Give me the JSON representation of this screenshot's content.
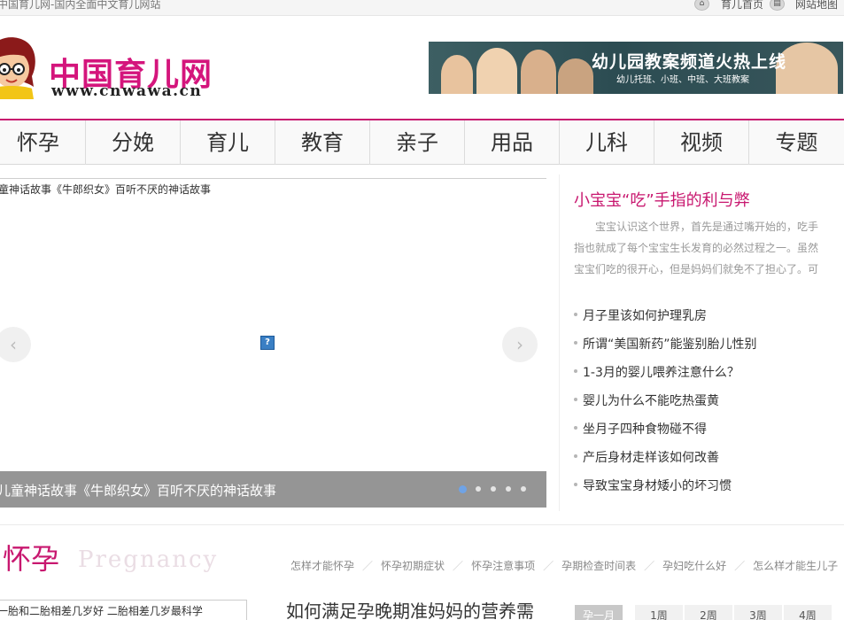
{
  "topbar": {
    "site_title": "中国育儿网-国内全面中文育儿网站",
    "links": [
      {
        "icon": "home-icon",
        "icon_glyph": "⌂",
        "label": "育儿首页"
      },
      {
        "icon": "sitemap-icon",
        "icon_glyph": "▤",
        "label": "网站地图"
      }
    ]
  },
  "header": {
    "logo_cn": "中国育儿网",
    "logo_url": "www.cnwawa.cn",
    "banner_title": "幼儿园教案频道火热上线",
    "banner_sub": "幼儿托班、小班、中班、大班教案"
  },
  "nav": {
    "items": [
      "怀孕",
      "分娩",
      "育儿",
      "教育",
      "亲子",
      "用品",
      "儿科",
      "视频",
      "专题"
    ]
  },
  "slider": {
    "caption_top": "童神话故事《牛郎织女》百听不厌的神话故事",
    "caption_bottom": "儿童神话故事《牛郎织女》百听不厌的神话故事",
    "prev_glyph": "‹",
    "next_glyph": "›",
    "broken_image_glyph": "?",
    "dot_count": 5,
    "active_dot": 1
  },
  "featured": {
    "title": "小宝宝“吃”手指的利与弊",
    "desc": "宝宝认识这个世界，首先是通过嘴开始的，吃手指也就成了每个宝宝生长发育的必然过程之一。虽然宝宝们吃的很开心，但是妈妈们就免不了担心了。可",
    "links": [
      "月子里该如何护理乳房",
      "所谓“美国新药”能鉴别胎儿性别",
      "1-3月的婴儿喂养注意什么？",
      "婴儿为什么不能吃热蛋黄",
      "坐月子四种食物碰不得",
      "产后身材走样该如何改善",
      "导致宝宝身材矮小的坏习惯"
    ]
  },
  "section": {
    "title": "怀孕",
    "title_en": "Pregnancy",
    "links": [
      "怎样才能怀孕",
      "怀孕初期症状",
      "怀孕注意事项",
      "孕期检查时间表",
      "孕妇吃什么好",
      "怎么样才能生儿子"
    ],
    "sub_list_text": "一胎和二胎相差几岁好 二胎相差几岁最科学",
    "article_title": "如何满足孕晚期准妈妈的营养需",
    "week_tabs": [
      "孕一月",
      "1周",
      "2周",
      "3周",
      "4周"
    ]
  },
  "colors": {
    "brand": "#c8176f",
    "dot_active": "#6fa3e6"
  }
}
